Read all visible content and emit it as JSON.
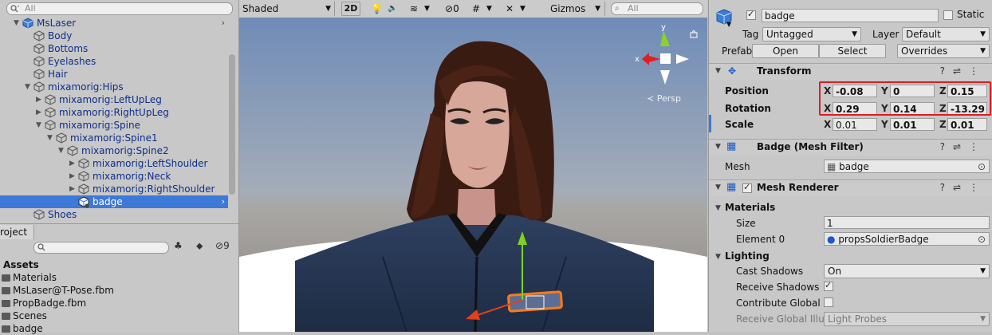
{
  "hierarchy": {
    "search_placeholder": "All",
    "items": [
      {
        "label": "MsLaser",
        "arrow": "▼",
        "chevron": "›"
      },
      {
        "label": "Body",
        "arrow": ""
      },
      {
        "label": "Bottoms",
        "arrow": ""
      },
      {
        "label": "Eyelashes",
        "arrow": ""
      },
      {
        "label": "Hair",
        "arrow": ""
      },
      {
        "label": "mixamorig:Hips",
        "arrow": "▼"
      },
      {
        "label": "mixamorig:LeftUpLeg",
        "arrow": "▶"
      },
      {
        "label": "mixamorig:RightUpLeg",
        "arrow": "▶"
      },
      {
        "label": "mixamorig:Spine",
        "arrow": "▼"
      },
      {
        "label": "mixamorig:Spine1",
        "arrow": "▼"
      },
      {
        "label": "mixamorig:Spine2",
        "arrow": "▼"
      },
      {
        "label": "mixamorig:LeftShoulder",
        "arrow": "▶"
      },
      {
        "label": "mixamorig:Neck",
        "arrow": "▶"
      },
      {
        "label": "mixamorig:RightShoulder",
        "arrow": "▶"
      },
      {
        "label": "badge",
        "arrow": "",
        "selected": true,
        "chevron": "›"
      },
      {
        "label": "Shoes",
        "arrow": ""
      }
    ]
  },
  "project": {
    "tab_label": "roject",
    "hidden_count": "9",
    "assets_label": "Assets",
    "items": [
      "Materials",
      "MsLaser@T-Pose.fbm",
      "PropBadge.fbm",
      "Scenes",
      "badge"
    ]
  },
  "scene": {
    "shading_mode": "Shaded",
    "mode_2d": "2D",
    "hidden_count": "0",
    "gizmos_label": "Gizmos",
    "search_placeholder": "All",
    "gizmo_y": "y",
    "gizmo_x": "x",
    "persp_label": "Persp",
    "colors": {
      "sky_top": "#6f8cb8",
      "horizon": "#a8a6a2",
      "ground": "#8a8582",
      "floor": "#ffffff"
    }
  },
  "inspector": {
    "object_name": "badge",
    "static_label": "Static",
    "tag_label": "Tag",
    "tag_value": "Untagged",
    "layer_label": "Layer",
    "layer_value": "Default",
    "prefab_label": "Prefab",
    "open_label": "Open",
    "select_label": "Select",
    "overrides_label": "Overrides",
    "transform": {
      "title": "Transform",
      "position_label": "Position",
      "rotation_label": "Rotation",
      "scale_label": "Scale",
      "position": {
        "x": "-0.08",
        "y": "0",
        "z": "0.15"
      },
      "rotation": {
        "x": "0.29",
        "y": "0.14",
        "z": "-13.29"
      },
      "scale": {
        "x": "0.01",
        "y": "0.01",
        "z": "0.01"
      }
    },
    "mesh_filter": {
      "title": "Badge (Mesh Filter)",
      "mesh_label": "Mesh",
      "mesh_value": "badge"
    },
    "mesh_renderer": {
      "title": "Mesh Renderer",
      "materials_label": "Materials",
      "size_label": "Size",
      "size_value": "1",
      "element0_label": "Element 0",
      "element0_value": "propsSoldierBadge",
      "lighting_label": "Lighting",
      "cast_shadows_label": "Cast Shadows",
      "cast_shadows_value": "On",
      "receive_shadows_label": "Receive Shadows",
      "contribute_gi_label": "Contribute Global Il",
      "receive_gi_label": "Receive Global Illu",
      "receive_gi_value": "Light Probes"
    },
    "highlight_color": "#e01b24"
  },
  "axes": {
    "x_label": "X",
    "y_label": "Y",
    "z_label": "Z"
  }
}
